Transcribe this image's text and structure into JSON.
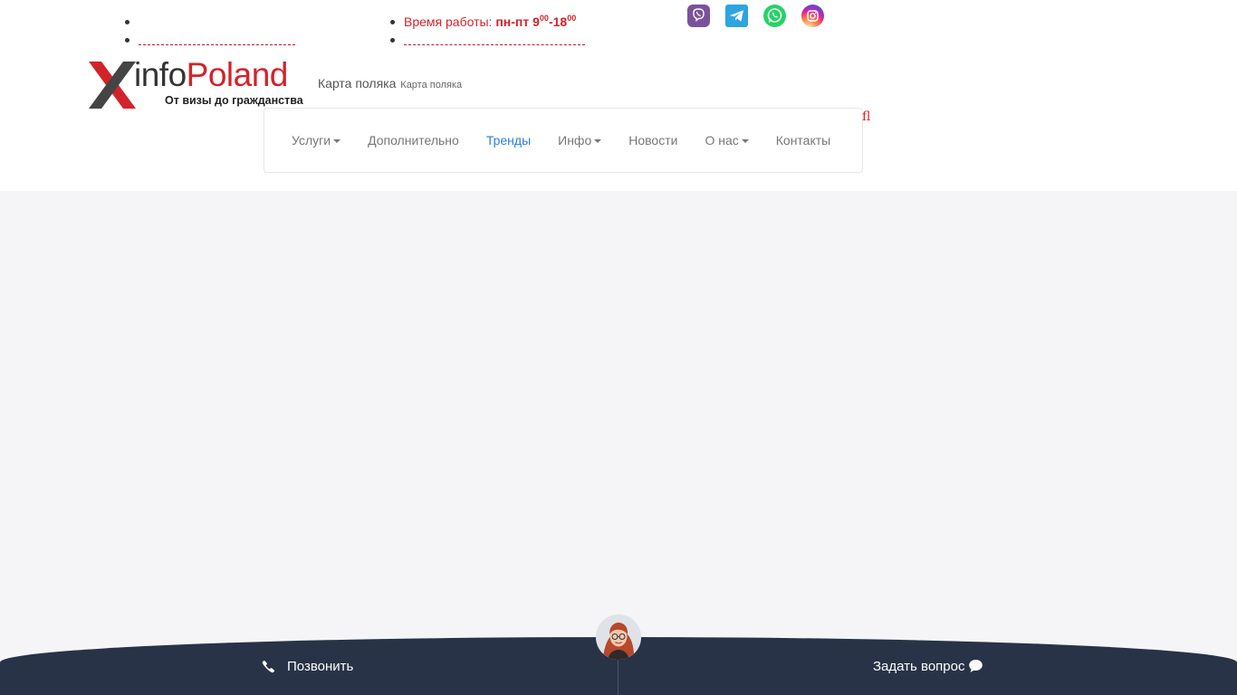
{
  "header": {
    "hours": {
      "label": "Время работы: ",
      "days": "пн-пт",
      "open_hour": "9",
      "open_min": "00",
      "separator": "-",
      "close_hour": "18",
      "close_min": "00"
    },
    "social_icons": [
      "viber-icon",
      "telegram-icon",
      "whatsapp-icon",
      "instagram-icon"
    ],
    "logo": {
      "text_part1": "info",
      "text_part2": "Poland",
      "tagline": "От визы до гражданства"
    },
    "karta_link": "Карта поляка",
    "karta_small": "Карта поляка",
    "search_glyph": "fl"
  },
  "nav": {
    "items": [
      {
        "label": "Услуги",
        "dropdown": true
      },
      {
        "label": "Дополнительно",
        "dropdown": false
      },
      {
        "label": "Тренды",
        "dropdown": false,
        "active": true
      },
      {
        "label": "Инфо",
        "dropdown": true
      },
      {
        "label": "Новости",
        "dropdown": false
      },
      {
        "label": "О нас",
        "dropdown": true
      },
      {
        "label": "Контакты",
        "dropdown": false
      }
    ]
  },
  "bottom_bar": {
    "call_label": "Позвонить",
    "ask_label": "Задать вопрос"
  },
  "colors": {
    "accent_red": "#d2232a",
    "nav_active": "#2a7ee1",
    "bottom_bar": "#283347",
    "main_bg": "#f5f5f7"
  }
}
